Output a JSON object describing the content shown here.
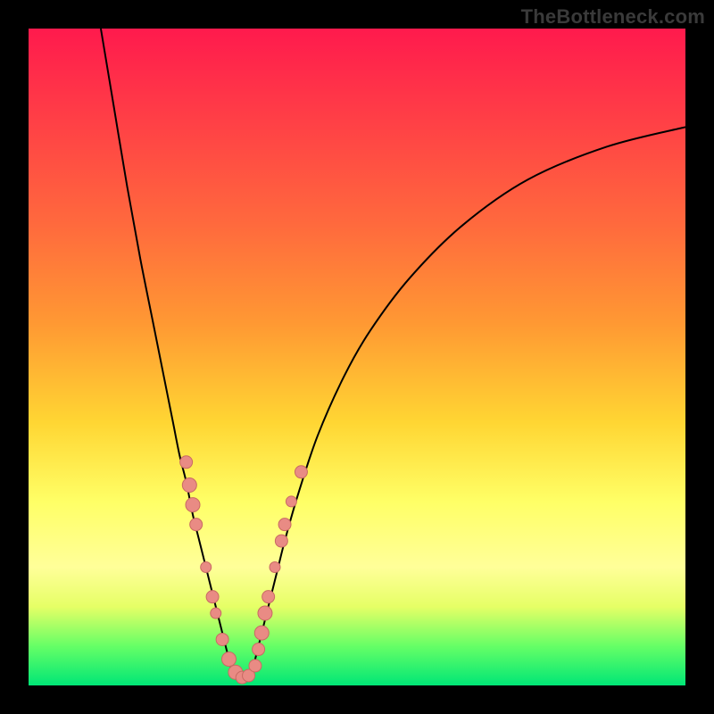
{
  "watermark": "TheBottleneck.com",
  "colors": {
    "curve": "#000000",
    "marker_fill": "#e98b84",
    "marker_stroke": "#c96a63",
    "frame": "#000000"
  },
  "chart_data": {
    "type": "line",
    "title": "",
    "xlabel": "",
    "ylabel": "",
    "xlim": [
      0,
      100
    ],
    "ylim": [
      0,
      100
    ],
    "grid": false,
    "legend": false,
    "series": [
      {
        "name": "left-branch",
        "x": [
          11,
          13,
          15,
          17,
          19,
          21,
          22,
          23,
          24,
          25,
          26,
          27,
          28,
          29,
          30,
          31
        ],
        "y": [
          100,
          88,
          76,
          65,
          55,
          45,
          40,
          35,
          31,
          26,
          22,
          18,
          14,
          10,
          6,
          2
        ]
      },
      {
        "name": "right-branch",
        "x": [
          34,
          35,
          36,
          37,
          38,
          39,
          41,
          44,
          48,
          52,
          58,
          66,
          76,
          88,
          100
        ],
        "y": [
          2,
          6,
          10,
          14,
          18,
          22,
          29,
          38,
          47,
          54,
          62,
          70,
          77,
          82,
          85
        ]
      },
      {
        "name": "valley-floor",
        "x": [
          31,
          32,
          33,
          34
        ],
        "y": [
          2,
          1,
          1,
          2
        ]
      }
    ],
    "markers": [
      {
        "x": 24.0,
        "y": 34.0,
        "r": 7
      },
      {
        "x": 24.5,
        "y": 30.5,
        "r": 8
      },
      {
        "x": 25.0,
        "y": 27.5,
        "r": 8
      },
      {
        "x": 25.5,
        "y": 24.5,
        "r": 7
      },
      {
        "x": 27.0,
        "y": 18.0,
        "r": 6
      },
      {
        "x": 28.0,
        "y": 13.5,
        "r": 7
      },
      {
        "x": 28.5,
        "y": 11.0,
        "r": 6
      },
      {
        "x": 29.5,
        "y": 7.0,
        "r": 7
      },
      {
        "x": 30.5,
        "y": 4.0,
        "r": 8
      },
      {
        "x": 31.5,
        "y": 2.0,
        "r": 8
      },
      {
        "x": 32.5,
        "y": 1.2,
        "r": 7
      },
      {
        "x": 33.5,
        "y": 1.5,
        "r": 7
      },
      {
        "x": 34.5,
        "y": 3.0,
        "r": 7
      },
      {
        "x": 35.0,
        "y": 5.5,
        "r": 7
      },
      {
        "x": 35.5,
        "y": 8.0,
        "r": 8
      },
      {
        "x": 36.0,
        "y": 11.0,
        "r": 8
      },
      {
        "x": 36.5,
        "y": 13.5,
        "r": 7
      },
      {
        "x": 37.5,
        "y": 18.0,
        "r": 6
      },
      {
        "x": 38.5,
        "y": 22.0,
        "r": 7
      },
      {
        "x": 39.0,
        "y": 24.5,
        "r": 7
      },
      {
        "x": 40.0,
        "y": 28.0,
        "r": 6
      },
      {
        "x": 41.5,
        "y": 32.5,
        "r": 7
      }
    ]
  }
}
